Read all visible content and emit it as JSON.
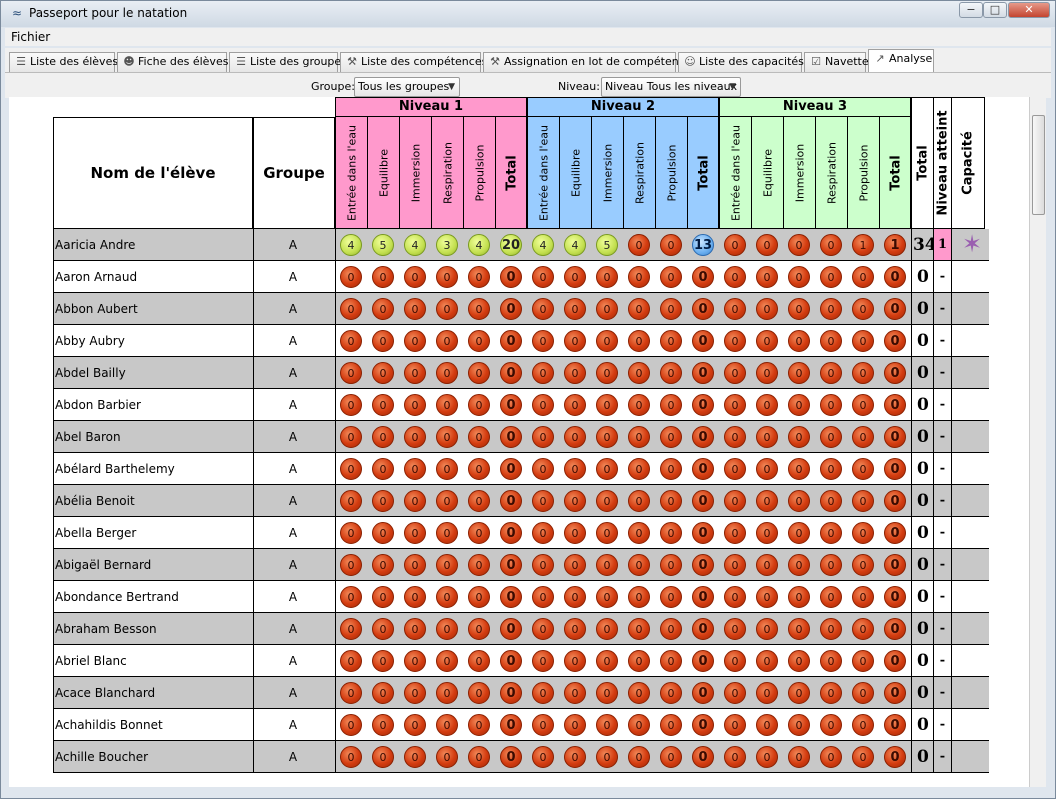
{
  "window": {
    "title": "Passeport pour le natation",
    "minimize": "−",
    "maximize": "□",
    "close": "✕"
  },
  "menu": {
    "fichier": "Fichier"
  },
  "tabs": [
    {
      "label": "Liste des élèves",
      "icon": "list-icon"
    },
    {
      "label": "Fiche des élèves",
      "icon": "person-icon"
    },
    {
      "label": "Liste des groupes",
      "icon": "list-icon"
    },
    {
      "label": "Liste des compétences",
      "icon": "gavel-icon"
    },
    {
      "label": "Assignation en lot de compétences",
      "icon": "gavel-icon"
    },
    {
      "label": "Liste des capacités",
      "icon": "badge-icon"
    },
    {
      "label": "Navette",
      "icon": "checklist-icon"
    },
    {
      "label": "Analyse",
      "icon": "chart-icon"
    }
  ],
  "filters": {
    "groupe_label": "Groupe:",
    "groupe_value": "Tous les groupes",
    "niveau_label": "Niveau:",
    "niveau_value": "Niveau Tous les niveaux"
  },
  "table": {
    "col_name": "Nom de l'élève",
    "col_group": "Groupe",
    "levels": [
      {
        "title": "Niveau 1",
        "color": "#ff99cc"
      },
      {
        "title": "Niveau 2",
        "color": "#99ccff"
      },
      {
        "title": "Niveau 3",
        "color": "#ccffcc"
      }
    ],
    "subcols": [
      "Entrée dans l'eau",
      "Equilibre",
      "Immersion",
      "Respiration",
      "Propulsion",
      "Total"
    ],
    "col_total": "Total",
    "col_niveau": "Niveau atteint",
    "col_capacite": "Capacité",
    "rows": [
      {
        "name": "Aaricia Andre",
        "group": "A",
        "n1": [
          "4",
          "5",
          "4",
          "3",
          "4",
          "20"
        ],
        "n2": [
          "4",
          "4",
          "5",
          "0",
          "0",
          "13"
        ],
        "n3": [
          "0",
          "0",
          "0",
          "0",
          "1",
          "1"
        ],
        "total": "34",
        "niveau": "1",
        "capacite": "starfish-icon"
      },
      {
        "name": "Aaron Arnaud",
        "group": "A",
        "n1": [
          "0",
          "0",
          "0",
          "0",
          "0",
          "0"
        ],
        "n2": [
          "0",
          "0",
          "0",
          "0",
          "0",
          "0"
        ],
        "n3": [
          "0",
          "0",
          "0",
          "0",
          "0",
          "0"
        ],
        "total": "0",
        "niveau": "-"
      },
      {
        "name": "Abbon Aubert",
        "group": "A",
        "n1": [
          "0",
          "0",
          "0",
          "0",
          "0",
          "0"
        ],
        "n2": [
          "0",
          "0",
          "0",
          "0",
          "0",
          "0"
        ],
        "n3": [
          "0",
          "0",
          "0",
          "0",
          "0",
          "0"
        ],
        "total": "0",
        "niveau": "-"
      },
      {
        "name": "Abby Aubry",
        "group": "A",
        "n1": [
          "0",
          "0",
          "0",
          "0",
          "0",
          "0"
        ],
        "n2": [
          "0",
          "0",
          "0",
          "0",
          "0",
          "0"
        ],
        "n3": [
          "0",
          "0",
          "0",
          "0",
          "0",
          "0"
        ],
        "total": "0",
        "niveau": "-"
      },
      {
        "name": "Abdel Bailly",
        "group": "A",
        "n1": [
          "0",
          "0",
          "0",
          "0",
          "0",
          "0"
        ],
        "n2": [
          "0",
          "0",
          "0",
          "0",
          "0",
          "0"
        ],
        "n3": [
          "0",
          "0",
          "0",
          "0",
          "0",
          "0"
        ],
        "total": "0",
        "niveau": "-"
      },
      {
        "name": "Abdon Barbier",
        "group": "A",
        "n1": [
          "0",
          "0",
          "0",
          "0",
          "0",
          "0"
        ],
        "n2": [
          "0",
          "0",
          "0",
          "0",
          "0",
          "0"
        ],
        "n3": [
          "0",
          "0",
          "0",
          "0",
          "0",
          "0"
        ],
        "total": "0",
        "niveau": "-"
      },
      {
        "name": "Abel Baron",
        "group": "A",
        "n1": [
          "0",
          "0",
          "0",
          "0",
          "0",
          "0"
        ],
        "n2": [
          "0",
          "0",
          "0",
          "0",
          "0",
          "0"
        ],
        "n3": [
          "0",
          "0",
          "0",
          "0",
          "0",
          "0"
        ],
        "total": "0",
        "niveau": "-"
      },
      {
        "name": "Abélard Barthelemy",
        "group": "A",
        "n1": [
          "0",
          "0",
          "0",
          "0",
          "0",
          "0"
        ],
        "n2": [
          "0",
          "0",
          "0",
          "0",
          "0",
          "0"
        ],
        "n3": [
          "0",
          "0",
          "0",
          "0",
          "0",
          "0"
        ],
        "total": "0",
        "niveau": "-"
      },
      {
        "name": "Abélia Benoit",
        "group": "A",
        "n1": [
          "0",
          "0",
          "0",
          "0",
          "0",
          "0"
        ],
        "n2": [
          "0",
          "0",
          "0",
          "0",
          "0",
          "0"
        ],
        "n3": [
          "0",
          "0",
          "0",
          "0",
          "0",
          "0"
        ],
        "total": "0",
        "niveau": "-"
      },
      {
        "name": "Abella Berger",
        "group": "A",
        "n1": [
          "0",
          "0",
          "0",
          "0",
          "0",
          "0"
        ],
        "n2": [
          "0",
          "0",
          "0",
          "0",
          "0",
          "0"
        ],
        "n3": [
          "0",
          "0",
          "0",
          "0",
          "0",
          "0"
        ],
        "total": "0",
        "niveau": "-"
      },
      {
        "name": "Abigaël Bernard",
        "group": "A",
        "n1": [
          "0",
          "0",
          "0",
          "0",
          "0",
          "0"
        ],
        "n2": [
          "0",
          "0",
          "0",
          "0",
          "0",
          "0"
        ],
        "n3": [
          "0",
          "0",
          "0",
          "0",
          "0",
          "0"
        ],
        "total": "0",
        "niveau": "-"
      },
      {
        "name": "Abondance Bertrand",
        "group": "A",
        "n1": [
          "0",
          "0",
          "0",
          "0",
          "0",
          "0"
        ],
        "n2": [
          "0",
          "0",
          "0",
          "0",
          "0",
          "0"
        ],
        "n3": [
          "0",
          "0",
          "0",
          "0",
          "0",
          "0"
        ],
        "total": "0",
        "niveau": "-"
      },
      {
        "name": "Abraham Besson",
        "group": "A",
        "n1": [
          "0",
          "0",
          "0",
          "0",
          "0",
          "0"
        ],
        "n2": [
          "0",
          "0",
          "0",
          "0",
          "0",
          "0"
        ],
        "n3": [
          "0",
          "0",
          "0",
          "0",
          "0",
          "0"
        ],
        "total": "0",
        "niveau": "-"
      },
      {
        "name": "Abriel Blanc",
        "group": "A",
        "n1": [
          "0",
          "0",
          "0",
          "0",
          "0",
          "0"
        ],
        "n2": [
          "0",
          "0",
          "0",
          "0",
          "0",
          "0"
        ],
        "n3": [
          "0",
          "0",
          "0",
          "0",
          "0",
          "0"
        ],
        "total": "0",
        "niveau": "-"
      },
      {
        "name": "Acace Blanchard",
        "group": "A",
        "n1": [
          "0",
          "0",
          "0",
          "0",
          "0",
          "0"
        ],
        "n2": [
          "0",
          "0",
          "0",
          "0",
          "0",
          "0"
        ],
        "n3": [
          "0",
          "0",
          "0",
          "0",
          "0",
          "0"
        ],
        "total": "0",
        "niveau": "-"
      },
      {
        "name": "Achahildis Bonnet",
        "group": "A",
        "n1": [
          "0",
          "0",
          "0",
          "0",
          "0",
          "0"
        ],
        "n2": [
          "0",
          "0",
          "0",
          "0",
          "0",
          "0"
        ],
        "n3": [
          "0",
          "0",
          "0",
          "0",
          "0",
          "0"
        ],
        "total": "0",
        "niveau": "-"
      },
      {
        "name": "Achille Boucher",
        "group": "A",
        "n1": [
          "0",
          "0",
          "0",
          "0",
          "0",
          "0"
        ],
        "n2": [
          "0",
          "0",
          "0",
          "0",
          "0",
          "0"
        ],
        "n3": [
          "0",
          "0",
          "0",
          "0",
          "0",
          "0"
        ],
        "total": "0",
        "niveau": "-"
      }
    ]
  }
}
